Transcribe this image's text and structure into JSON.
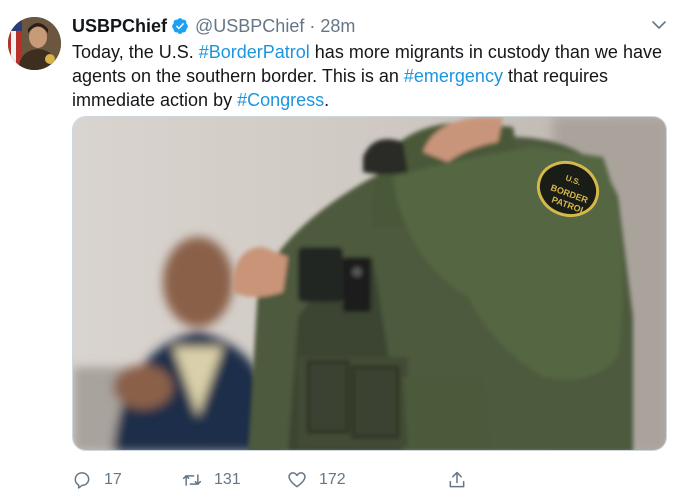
{
  "tweet": {
    "display_name": "USBPChief",
    "handle": "@USBPChief",
    "separator": "·",
    "time": "28m",
    "text_parts": {
      "p1": "Today, the U.S. ",
      "tag1": "#BorderPatrol",
      "p2": " has more migrants in custody than we have agents on the southern border. This is an ",
      "tag2": "#emergency",
      "p3": " that requires immediate action by ",
      "tag3": "#Congress",
      "p4": "."
    },
    "patch_text": {
      "line1": "U.S.",
      "line2": "BORDER",
      "line3": "PATROL"
    }
  },
  "actions": {
    "replies": "17",
    "retweets": "131",
    "likes": "172"
  },
  "colors": {
    "link": "#1b95e0",
    "muted": "#657786",
    "verified": "#1da1f2",
    "uniform": "#4a5a3a"
  },
  "icons": {
    "verified": "verified-badge-icon",
    "menu": "chevron-down-icon",
    "reply": "reply-icon",
    "retweet": "retweet-icon",
    "like": "heart-icon",
    "share": "share-icon"
  }
}
